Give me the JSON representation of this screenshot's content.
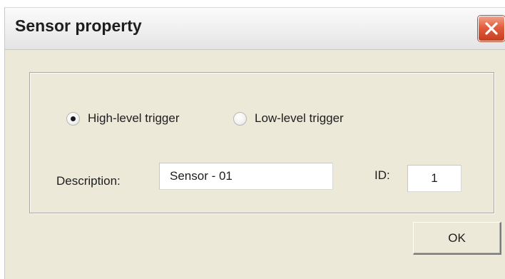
{
  "window": {
    "title": "Sensor property",
    "close_icon": "close-icon",
    "close_color": "#e35e3e"
  },
  "trigger": {
    "options": [
      {
        "label": "High-level trigger",
        "selected": true
      },
      {
        "label": "Low-level trigger",
        "selected": false
      }
    ]
  },
  "form": {
    "description_label": "Description:",
    "description_value": "Sensor - 01",
    "id_label": "ID:",
    "id_value": "1"
  },
  "buttons": {
    "ok_label": "OK"
  }
}
